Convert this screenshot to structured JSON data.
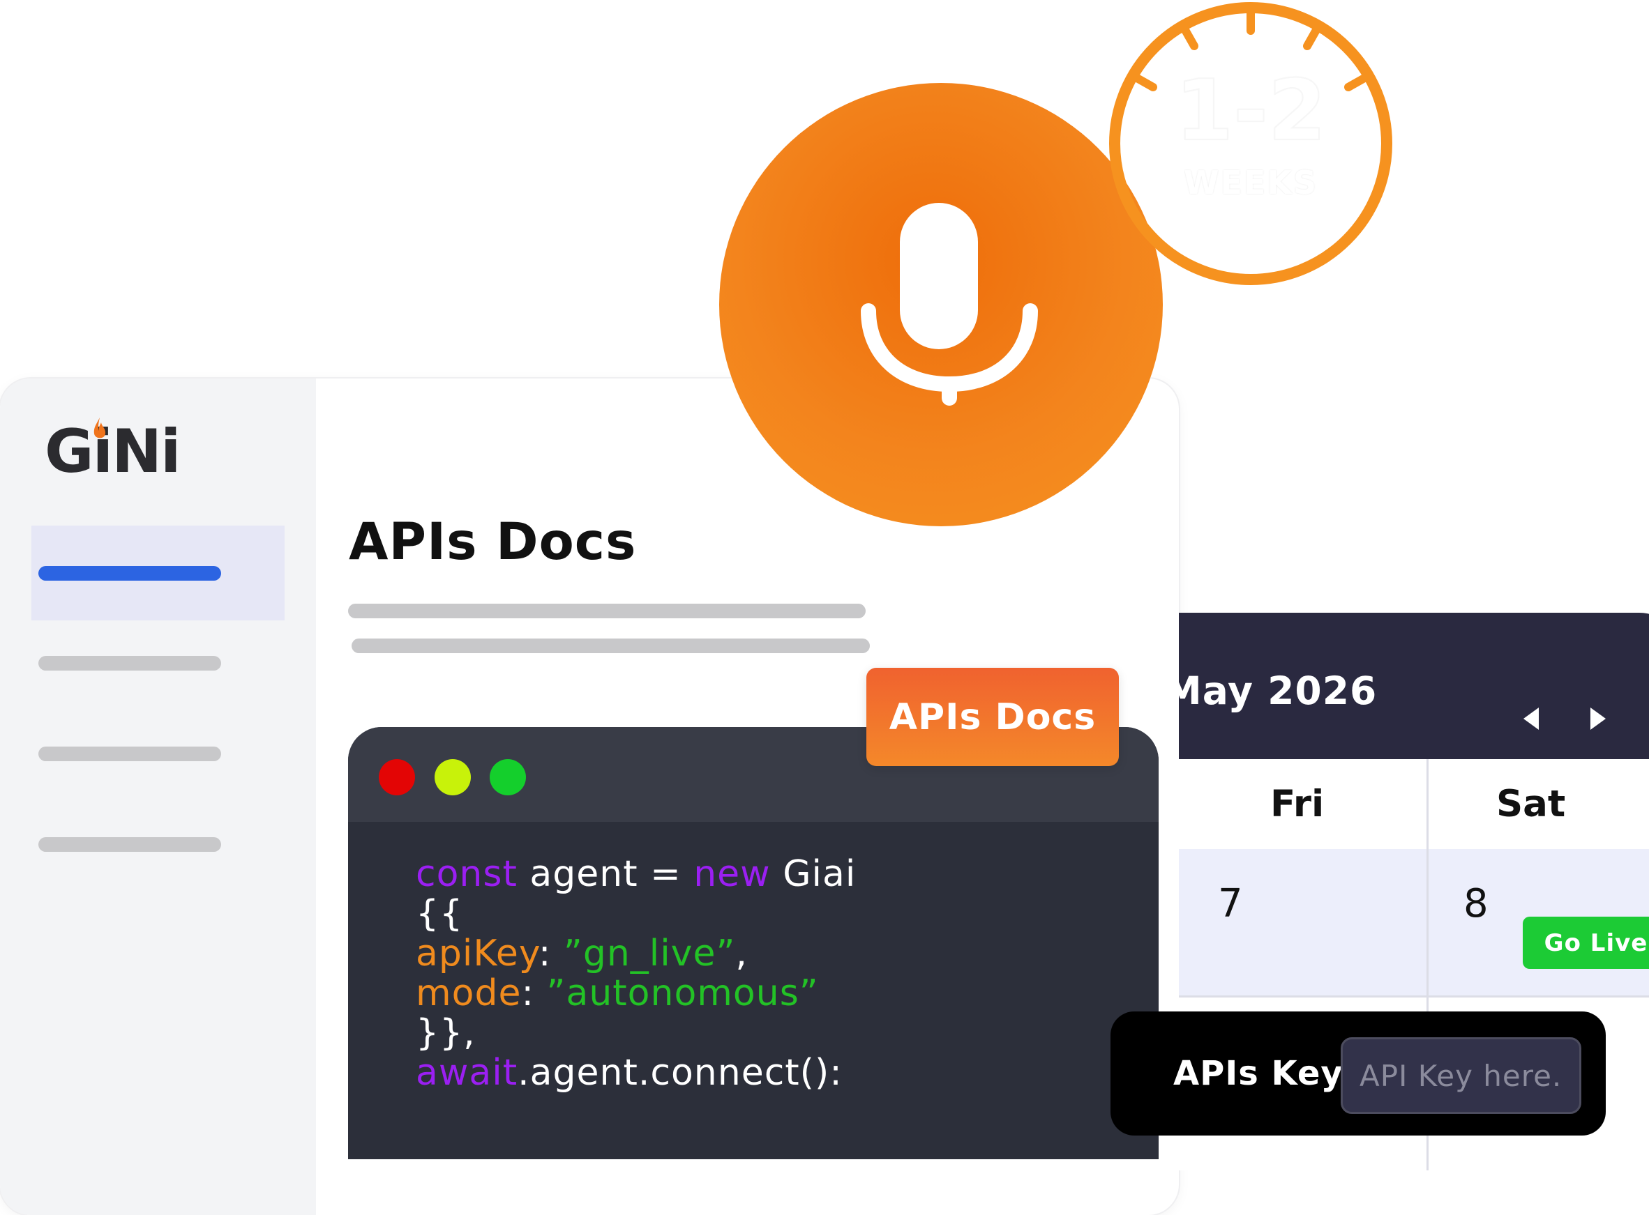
{
  "brand": {
    "logo_text": "GiNi"
  },
  "page": {
    "title": "APIs Docs"
  },
  "docs_button": {
    "label": "APIs Docs"
  },
  "editor": {
    "lines": [
      [
        {
          "t": "const",
          "c": "kw"
        },
        {
          "t": " agent = ",
          "c": "plain"
        },
        {
          "t": "new",
          "c": "kw"
        },
        {
          "t": " Giai",
          "c": "plain"
        }
      ],
      [
        {
          "t": "{{",
          "c": "plain"
        }
      ],
      [
        {
          "t": "apiKey",
          "c": "prop"
        },
        {
          "t": ": ",
          "c": "plain"
        },
        {
          "t": "”gn_live”",
          "c": "str"
        },
        {
          "t": ",",
          "c": "plain"
        }
      ],
      [
        {
          "t": "mode",
          "c": "prop"
        },
        {
          "t": ": ",
          "c": "plain"
        },
        {
          "t": "”autonomous”",
          "c": "str"
        }
      ],
      [
        {
          "t": "}},",
          "c": "plain"
        }
      ],
      [
        {
          "t": "await",
          "c": "kw"
        },
        {
          "t": ".agent.connect():",
          "c": "plain"
        }
      ]
    ]
  },
  "calendar": {
    "month": "May 2026",
    "days": [
      "Fri",
      "Sat"
    ],
    "dates": [
      "7",
      "8"
    ],
    "event": "Go Live"
  },
  "apikey": {
    "label": "APIs Key",
    "placeholder": "API Key here.."
  },
  "timer": {
    "value": "1-2",
    "unit": "WEEKS"
  },
  "colors": {
    "accent_orange": "#f3841d",
    "active_blue": "#2c64e2",
    "go_live_green": "#1ccb35",
    "calendar_header": "#2a2940"
  },
  "icons": [
    "flame-icon",
    "microphone-icon",
    "chevron-left-icon",
    "chevron-right-icon",
    "window-close-dot",
    "window-minimize-dot",
    "window-maximize-dot"
  ]
}
